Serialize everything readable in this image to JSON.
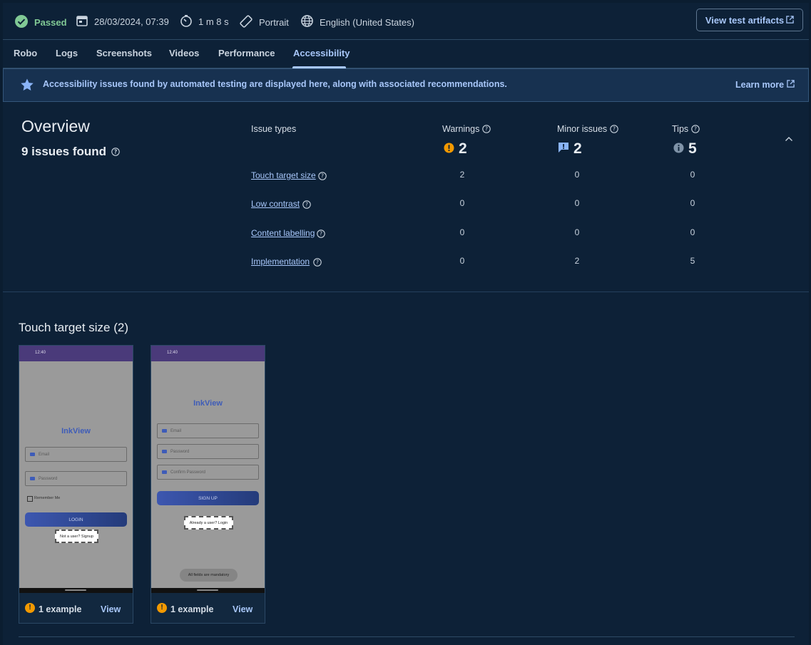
{
  "topbar": {
    "status": "Passed",
    "date": "28/03/2024, 07:39",
    "duration": "1 m 8 s",
    "orientation": "Portrait",
    "locale": "English (United States)",
    "artifacts_button": "View test artifacts"
  },
  "tabs": [
    "Robo",
    "Logs",
    "Screenshots",
    "Videos",
    "Performance",
    "Accessibility"
  ],
  "active_tab": "Accessibility",
  "banner": {
    "text": "Accessibility issues found by automated testing are displayed here, along with associated recommendations.",
    "learn_more": "Learn more"
  },
  "overview": {
    "title": "Overview",
    "issues_found": "9 issues found",
    "issue_types_label": "Issue types",
    "columns": [
      {
        "label": "Warnings",
        "total": "2",
        "icon": "warning-icon",
        "color": "#f29900"
      },
      {
        "label": "Minor issues",
        "total": "2",
        "icon": "feedback-icon",
        "color": "#8ab4f8"
      },
      {
        "label": "Tips",
        "total": "5",
        "icon": "info-icon",
        "color": "#7f93a8"
      }
    ],
    "rows": [
      {
        "name": "Touch target size",
        "values": [
          "2",
          "0",
          "0"
        ]
      },
      {
        "name": "Low contrast",
        "values": [
          "0",
          "0",
          "0"
        ]
      },
      {
        "name": "Content labelling",
        "values": [
          "0",
          "0",
          "0"
        ]
      },
      {
        "name": "Implementation",
        "values": [
          "0",
          "2",
          "5"
        ]
      }
    ]
  },
  "section": {
    "title": "Touch target size (2)",
    "cards": [
      {
        "status_time": "12:40",
        "app_title": "InkView",
        "fields": [
          "Email",
          "Password"
        ],
        "checkbox": "Remember Me",
        "button": "LOGIN",
        "highlight": "Not a user? Signup",
        "example": "1 example",
        "view": "View"
      },
      {
        "status_time": "12:40",
        "app_title": "InkView",
        "fields": [
          "Email",
          "Password",
          "Confirm Password"
        ],
        "button": "SIGN UP",
        "highlight": "Already a user? Login",
        "toast": "All fields are mandatory",
        "example": "1 example",
        "view": "View"
      }
    ]
  }
}
